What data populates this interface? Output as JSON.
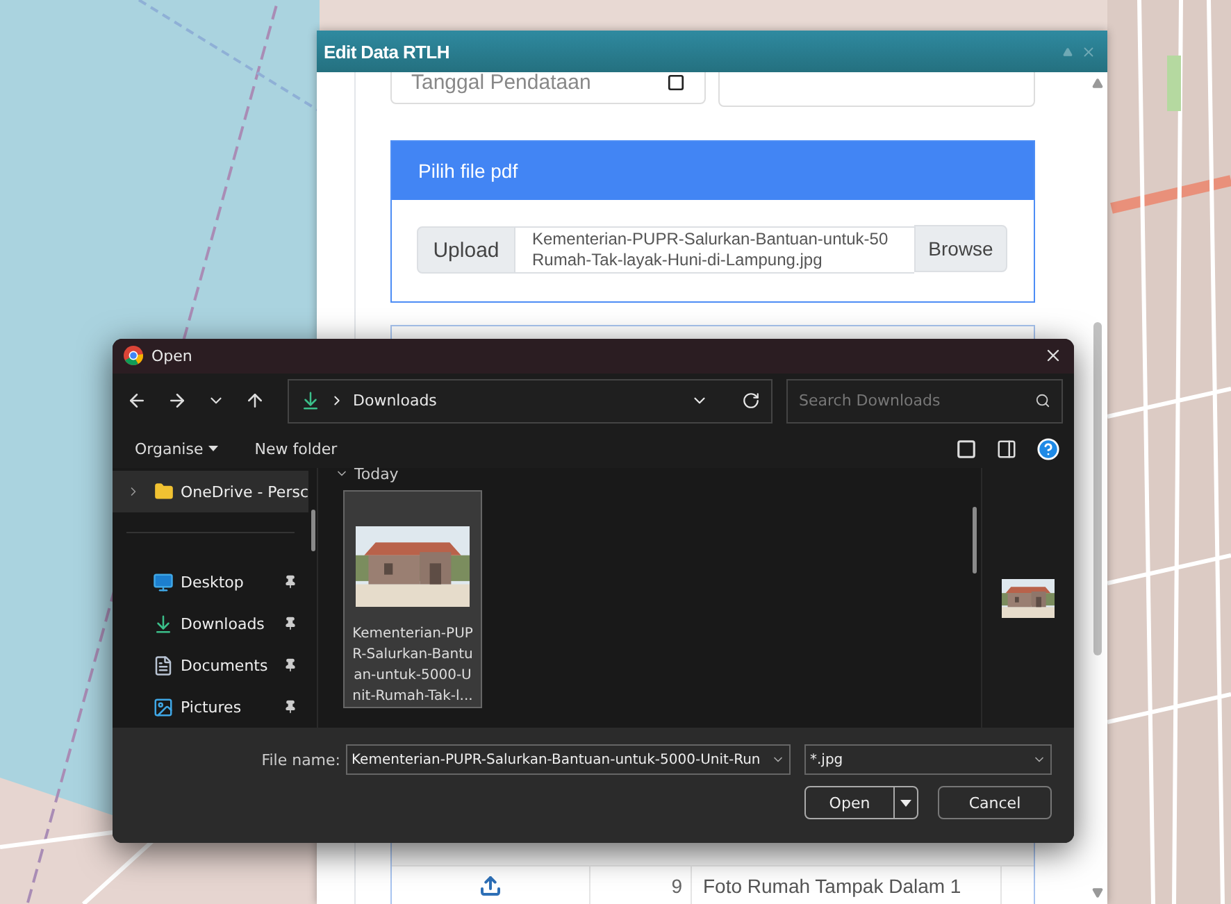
{
  "edit_modal": {
    "title": "Edit Data RTLH",
    "date_field": {
      "placeholder": "Tanggal Pendataan"
    },
    "file_card": {
      "title": "Pilih file pdf",
      "upload_label": "Upload",
      "file_name_lines": [
        "Kementerian-PUPR-Salurkan-Bantuan-untuk-50",
        "Rumah-Tak-layak-Huni-di-Lampung.jpg"
      ],
      "browse_label": "Browse"
    },
    "table_rows": [
      {
        "number": "9",
        "label": "Foto Rumah Tampak Dalam 1"
      }
    ]
  },
  "open_dialog": {
    "title": "Open",
    "path": "Downloads",
    "search": {
      "placeholder": "Search Downloads"
    },
    "commands": [
      "Organise",
      "New folder"
    ],
    "nav_items": [
      {
        "label": "OneDrive - Persc",
        "kind": "cloud",
        "pinned": false,
        "selected": true
      },
      {
        "label": "Desktop",
        "kind": "desktop",
        "pinned": true,
        "selected": false
      },
      {
        "label": "Downloads",
        "kind": "downloads",
        "pinned": true,
        "selected": false
      },
      {
        "label": "Documents",
        "kind": "documents",
        "pinned": true,
        "selected": false
      },
      {
        "label": "Pictures",
        "kind": "pictures",
        "pinned": true,
        "selected": false
      }
    ],
    "group": "Today",
    "files": [
      {
        "name": "Kementerian-PUPR-Salurkan-Bantuan-untuk-5000-Unit-Rumah-Tak-l...",
        "selected": true
      }
    ],
    "file_name_label": "File name:",
    "file_name": "Kementerian-PUPR-Salurkan-Bantuan-untuk-5000-Unit-Run",
    "file_type": "*.jpg",
    "buttons": [
      "Open",
      "Cancel"
    ]
  }
}
